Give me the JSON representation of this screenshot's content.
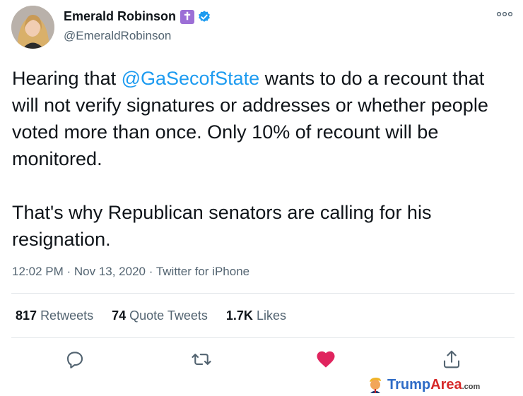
{
  "tweet": {
    "author_name": "Emerald Robinson",
    "name_badge": "✝",
    "handle": "@EmeraldRobinson",
    "text_p1_prefix": "Hearing that ",
    "mention": "@GaSecofState",
    "text_p1_suffix": " wants to do a recount that will not verify signatures or addresses or whether people voted more than once. Only 10% of recount will be monitored.",
    "text_p2": "That's why Republican senators are calling for his resignation.",
    "time": "12:02 PM",
    "separator": " · ",
    "date": "Nov 13, 2020",
    "source": "Twitter for iPhone"
  },
  "stats": {
    "retweets_count": "817",
    "retweets_label": "Retweets",
    "quotes_count": "74",
    "quotes_label": "Quote Tweets",
    "likes_count": "1.7K",
    "likes_label": "Likes"
  },
  "colors": {
    "accent": "#1d9bf0",
    "like": "#e0245e",
    "muted": "#536471",
    "text": "#0f1419"
  },
  "icons": [
    "more-icon",
    "verified-icon",
    "reply-icon",
    "retweet-icon",
    "like-icon",
    "share-icon"
  ],
  "watermark": {
    "part1": "Trump",
    "part2": "Area",
    "part3": ".com"
  }
}
